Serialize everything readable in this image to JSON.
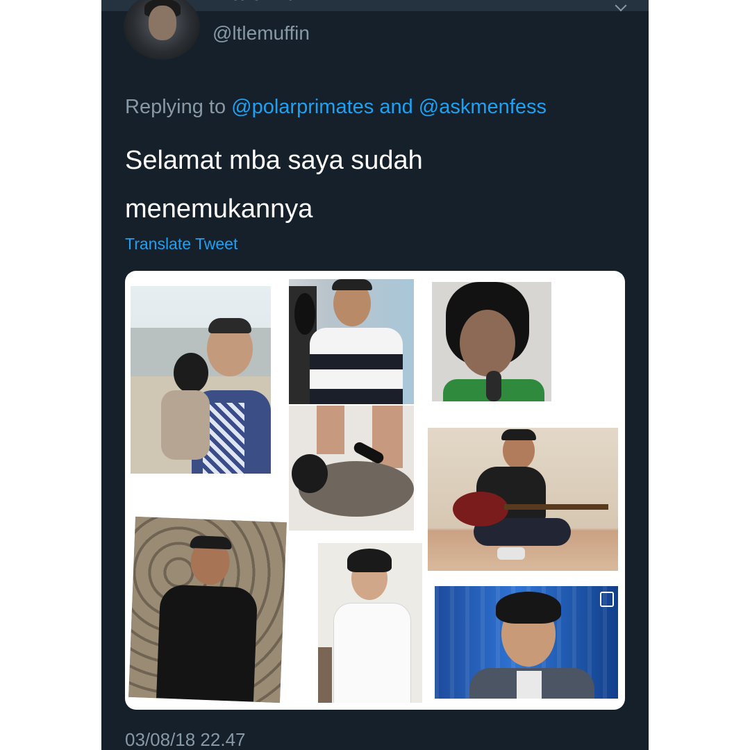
{
  "tweet": {
    "display_name": "Little Muffin",
    "handle": "@ltlemuffin",
    "reply_prefix": "Replying to",
    "reply_mention_1": "@polarprimates",
    "reply_joiner": "and",
    "reply_mention_2": "@askmenfess",
    "text": "Selamat mba saya sudah menemukannya",
    "translate_label": "Translate Tweet",
    "timestamp": "03/08/18 22.47"
  },
  "icons": {
    "avatar": "avatar",
    "menu": "chevron-down-icon"
  },
  "colors": {
    "background": "#15202b",
    "link": "#1da1f2",
    "secondary_text": "#8899a6",
    "primary_text": "#ffffff"
  }
}
